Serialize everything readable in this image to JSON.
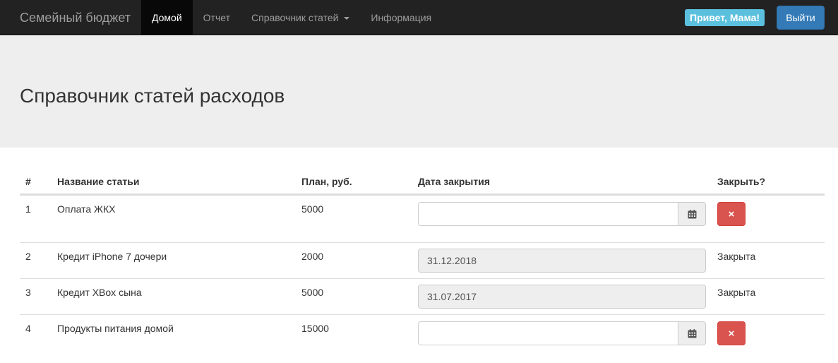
{
  "navbar": {
    "brand": "Семейный бюджет",
    "items": [
      {
        "label": "Домой",
        "active": true
      },
      {
        "label": "Отчет",
        "active": false
      },
      {
        "label": "Справочник статей",
        "active": false,
        "dropdown": true
      },
      {
        "label": "Информация",
        "active": false
      }
    ],
    "greeting": "Привет, Мама!",
    "logout_label": "Выйти"
  },
  "jumbotron": {
    "title": "Справочник статей расходов"
  },
  "table": {
    "headers": [
      "#",
      "Название статьи",
      "План, руб.",
      "Дата закрытия",
      "Закрыть?"
    ],
    "rows": [
      {
        "num": "1",
        "name": "Оплата ЖКХ",
        "plan": "5000",
        "date": "",
        "closed": false,
        "status": ""
      },
      {
        "num": "2",
        "name": "Кредит iPhone 7 дочери",
        "plan": "2000",
        "date": "31.12.2018",
        "closed": true,
        "status": "Закрыта"
      },
      {
        "num": "3",
        "name": "Кредит XBox сына",
        "plan": "5000",
        "date": "31.07.2017",
        "closed": true,
        "status": "Закрыта"
      },
      {
        "num": "4",
        "name": "Продукты питания домой",
        "plan": "15000",
        "date": "",
        "closed": false,
        "status": ""
      }
    ],
    "close_icon": "×",
    "calendar_icon": "calendar-icon"
  },
  "colors": {
    "navbar_bg": "#222222",
    "greeting_bg": "#5bc0de",
    "logout_bg": "#337ab7",
    "danger": "#d9534f",
    "jumbotron_bg": "#eeeeee"
  }
}
